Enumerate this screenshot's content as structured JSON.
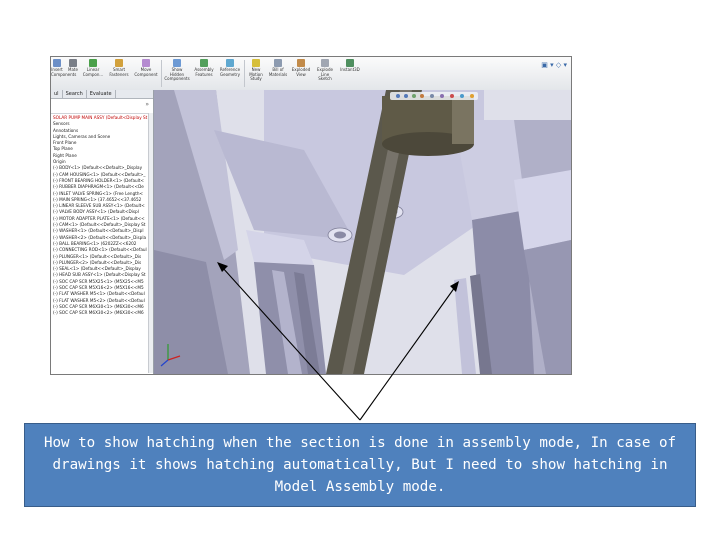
{
  "ribbon": {
    "buttons": [
      {
        "label": "Insert\nComponents",
        "icon": "insert-components-icon"
      },
      {
        "label": "Mate",
        "icon": "mate-icon"
      },
      {
        "label": "Linear\nCompon...",
        "icon": "linear-pattern-icon"
      },
      {
        "label": "Smart\nFasteners",
        "icon": "smart-fasteners-icon"
      },
      {
        "label": "Move\nComponent",
        "icon": "move-component-icon"
      },
      {
        "label": "Show\nHidden\nComponents",
        "icon": "show-hidden-icon"
      },
      {
        "label": "Assembly\nFeatures",
        "icon": "assembly-features-icon"
      },
      {
        "label": "Reference\nGeometry",
        "icon": "reference-geometry-icon"
      },
      {
        "label": "New\nMotion\nStudy",
        "icon": "motion-study-icon"
      },
      {
        "label": "Bill of\nMaterials",
        "icon": "bill-of-materials-icon"
      },
      {
        "label": "Exploded\nView",
        "icon": "exploded-view-icon"
      },
      {
        "label": "Explode\nLine\nSketch",
        "icon": "explode-line-sketch-icon"
      },
      {
        "label": "Instant3D",
        "icon": "instant3d-icon"
      }
    ]
  },
  "panel": {
    "tabs": [
      "ul",
      "Search",
      "Evaluate"
    ],
    "tree": [
      "SOLAR PUMP MAIN ASSY  (Default<Display St",
      "Sensors",
      "Annotations",
      "Lights, Cameras and Scene",
      "Front Plane",
      "Top Plane",
      "Right Plane",
      "Origin",
      "(-) BODY<1> (Default<<Default>_Display",
      "(-) CAM HOUSING<1> (Default<<Default>_",
      "(-) FRONT BEARING HOLDER<1> (Default<",
      "(-) RUBBER DIAPHRAGM<1> (Default<<De",
      "(-) INLET VALVE SPRING<1> (Free Length<",
      "(-) MAIN SPRING<1> (37.4652<<37.4652",
      "(-) LINEAR SLEEVE SUB ASSY<1> (Default<",
      "(-) VALVE BODY ASSY<1> (Default<Displ",
      "(-) MOTOR ADAPTER PLATE<1> (Default<<",
      "(-) CAM<1> (Default<<Default>_Display St",
      "(-) WASHER<1> (Default<<Default>_Displ",
      "(-) WASHER<2> (Default<<Default>_Displa",
      "(-) BALL BEARING<1> (6202ZZ<<6202",
      "(-) CONNECTING ROD<1> (Default<<Defaul",
      "(-) PLUNGER<1> (Default<<Default>_Dis",
      "(-) PLUNGER<2> (Default<<Default>_Dis",
      "(-) SEAL<1> (Default<<Default>_Display",
      "(-) HEAD SUB ASSY<1> (Default<Display St",
      "(-) SOC CAP SCR M5X25<1> (M5X25<<M5",
      "(-) SOC CAP SCR M5X16<2> (M5X16<<M5",
      "(-) FLAT WASHER M5<1> (Default<<Defaul",
      "(-) FLAT WASHER M5<2> (Default<<Defaul",
      "(-) SOC CAP SCR M6X30<1> (M6X30<<M6",
      "(-) SOC CAP SCR M6X30<2> (M6X30<<M6"
    ]
  },
  "colors": {
    "callout_fill": "#4f81bd",
    "callout_text": "#ffffff",
    "part_light": "#c9c9de",
    "part_mid": "#9d9db4",
    "part_dark": "#6b6b84",
    "shaft": "#5d594c"
  },
  "callout": {
    "text": "How to show hatching when the section is done in assembly mode, In case of drawings it shows hatching automatically, But I need to show hatching in Model Assembly mode."
  }
}
